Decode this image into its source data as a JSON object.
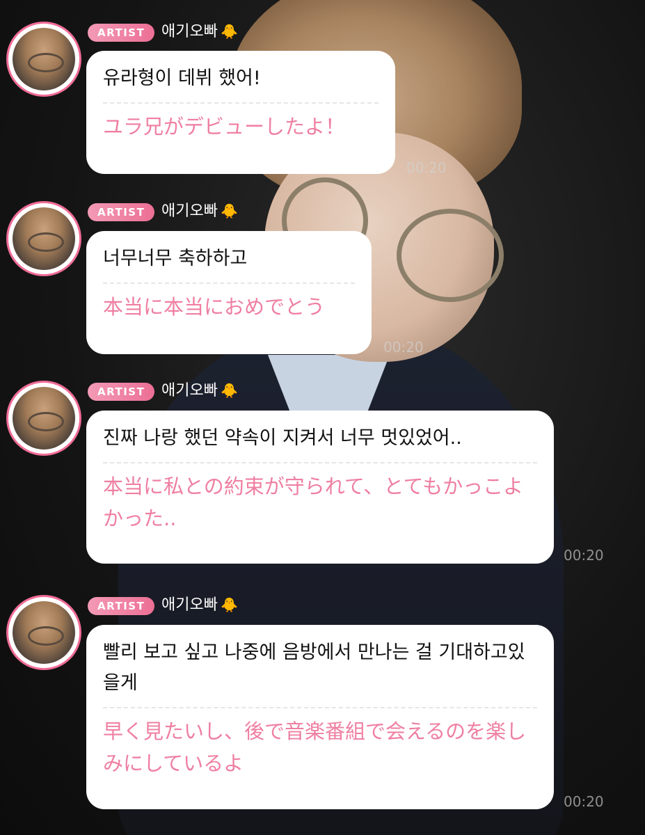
{
  "colors": {
    "accent": "#ec6f95",
    "japanese_text": "#ef7fa2",
    "badge_gradient_start": "#f39ab5"
  },
  "messages": [
    {
      "badge": "ARTIST",
      "name": "애기오빠",
      "emoji": "🐥",
      "korean": "유라형이 데뷔 했어!",
      "japanese": "ユラ兄がデビューしたよ！",
      "time": "00:20"
    },
    {
      "badge": "ARTIST",
      "name": "애기오빠",
      "emoji": "🐥",
      "korean": "너무너무 축하하고",
      "japanese": "本当に本当におめでとう",
      "time": "00:20"
    },
    {
      "badge": "ARTIST",
      "name": "애기오빠",
      "emoji": "🐥",
      "korean": "진짜 나랑 했던 약속이 지켜서 너무 멋있었어..",
      "japanese": "本当に私との約束が守られて、とてもかっこよかった..",
      "time": "00:20"
    },
    {
      "badge": "ARTIST",
      "name": "애기오빠",
      "emoji": "🐥",
      "korean": "빨리 보고 싶고 나중에 음방에서 만나는 걸 기대하고있을게",
      "japanese": "早く見たいし、後で音楽番組で会えるのを楽しみにしているよ",
      "time": "00:20"
    }
  ]
}
